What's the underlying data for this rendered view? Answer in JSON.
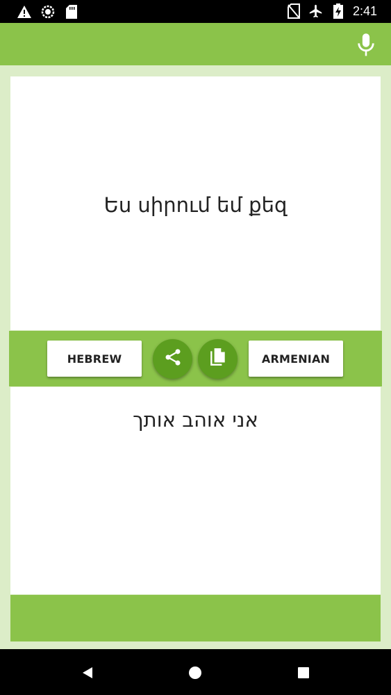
{
  "status_bar": {
    "time": "2:41",
    "icons_left": [
      "warning-icon",
      "sync-circle-icon",
      "sd-card-icon"
    ],
    "icons_right": [
      "no-sim-icon",
      "airplane-icon",
      "battery-charging-icon"
    ]
  },
  "app_bar": {
    "action_icon": "mic-icon"
  },
  "source_panel": {
    "text": "Ես սիրում եմ քեզ"
  },
  "toolbar": {
    "left_language": "HEBREW",
    "right_language": "ARMENIAN",
    "share_icon": "share-icon",
    "copy_icon": "copy-icon"
  },
  "target_panel": {
    "text": "אני אוהב אותך"
  },
  "nav_bar": {
    "icons": [
      "back-icon",
      "home-icon",
      "recents-icon"
    ]
  },
  "colors": {
    "primary": "#8bc34a",
    "primary_dark": "#5c9e1f",
    "background": "#dcedc8",
    "status_bar": "#000000"
  }
}
